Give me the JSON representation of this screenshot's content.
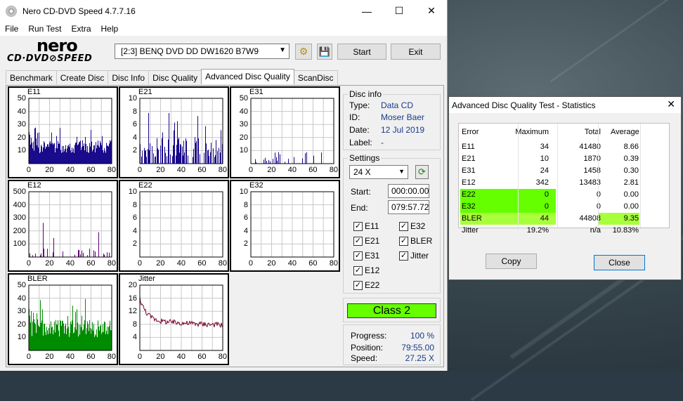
{
  "window": {
    "title": "Nero CD-DVD Speed 4.7.7.16",
    "minimize": "—",
    "maximize": "☐",
    "close": "✕"
  },
  "menu": [
    "File",
    "Run Test",
    "Extra",
    "Help"
  ],
  "logo": {
    "line1": "nero",
    "line2": "CD·DVD⊘SPEED"
  },
  "toolbar": {
    "drive": "[2:3]   BENQ DVD DD DW1620 B7W9",
    "start": "Start",
    "exit": "Exit"
  },
  "tabs": [
    "Benchmark",
    "Create Disc",
    "Disc Info",
    "Disc Quality",
    "Advanced Disc Quality",
    "ScanDisc"
  ],
  "active_tab": 4,
  "disc_info": {
    "title": "Disc info",
    "type_label": "Type:",
    "type": "Data CD",
    "id_label": "ID:",
    "id": "Moser Baer",
    "date_label": "Date:",
    "date": "12 Jul 2019",
    "label_label": "Label:",
    "label": "-"
  },
  "settings": {
    "title": "Settings",
    "speed": "24 X",
    "start_label": "Start:",
    "start": "000:00.00",
    "end_label": "End:",
    "end": "079:57.72",
    "checks": [
      "E11",
      "E32",
      "E21",
      "BLER",
      "E31",
      "Jitter",
      "E12",
      "E22"
    ]
  },
  "class": "Class 2",
  "progress": {
    "progress_label": "Progress:",
    "progress": "100 %",
    "position_label": "Position:",
    "position": "79:55.00",
    "speed_label": "Speed:",
    "speed": "27.25 X"
  },
  "graphs": {
    "x_ticks": [
      "0",
      "20",
      "40",
      "60",
      "80"
    ],
    "e11": {
      "name": "E11",
      "yticks": [
        "50",
        "40",
        "30",
        "20",
        "10"
      ]
    },
    "e21": {
      "name": "E21",
      "yticks": [
        "10",
        "8",
        "6",
        "4",
        "2"
      ]
    },
    "e31": {
      "name": "E31",
      "yticks": [
        "50",
        "40",
        "30",
        "20",
        "10"
      ]
    },
    "e12": {
      "name": "E12",
      "yticks": [
        "500",
        "400",
        "300",
        "200",
        "100"
      ]
    },
    "e22": {
      "name": "E22",
      "yticks": [
        "10",
        "8",
        "6",
        "4",
        "2"
      ]
    },
    "e32": {
      "name": "E32",
      "yticks": [
        "10",
        "8",
        "6",
        "4",
        "2"
      ]
    },
    "bler": {
      "name": "BLER",
      "yticks": [
        "50",
        "40",
        "30",
        "20",
        "10"
      ]
    },
    "jitter": {
      "name": "Jitter",
      "yticks": [
        "20",
        "16",
        "12",
        "8",
        "4"
      ]
    }
  },
  "stats": {
    "title": "Advanced Disc Quality Test - Statistics",
    "headers": [
      "Error",
      "Maximum",
      "Total",
      "Average"
    ],
    "rows": [
      [
        "E11",
        "34",
        "41480",
        "8.66"
      ],
      [
        "E21",
        "10",
        "1870",
        "0.39"
      ],
      [
        "E31",
        "24",
        "1458",
        "0.30"
      ],
      [
        "E12",
        "342",
        "13483",
        "2.81"
      ],
      [
        "E22",
        "0",
        "0",
        "0.00"
      ],
      [
        "E32",
        "0",
        "0",
        "0.00"
      ],
      [
        "BLER",
        "44",
        "44808",
        "9.35"
      ],
      [
        "Jitter",
        "19.2%",
        "n/a",
        "10.83%"
      ]
    ],
    "copy": "Copy",
    "close": "Close",
    "green": "#66ff00",
    "lime": "#a8ff3c"
  },
  "colors": {
    "e11": "#1a0a8c",
    "e21": "#1a0a8c",
    "e31": "#1a0a8c",
    "e12": "#5a007a",
    "bler": "#008c00",
    "jitter": "#7a0030"
  }
}
